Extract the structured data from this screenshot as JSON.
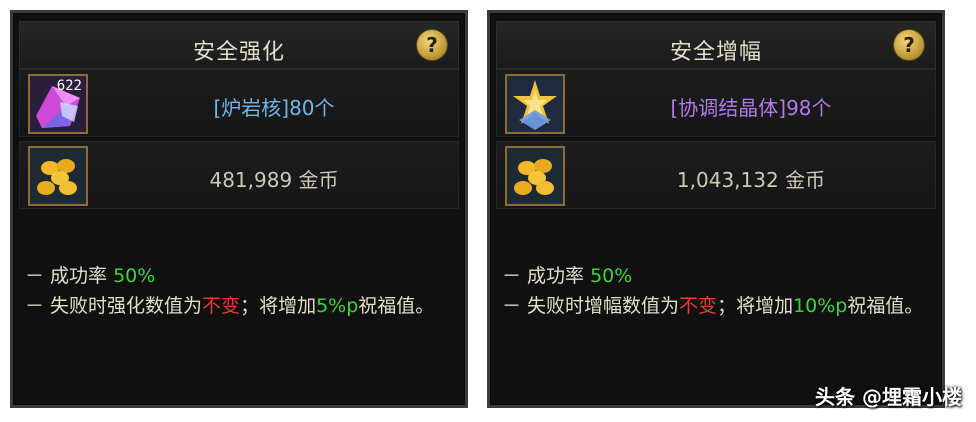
{
  "left": {
    "title": "安全强化",
    "help": "?",
    "material_count": "622",
    "material_text": "[炉岩核]80个",
    "gold_text": "481,989 金币",
    "rate_prefix": "－ 成功率 ",
    "rate_value": "50%",
    "fail_prefix": "－ 失败时强化数值为",
    "fail_unchanged": "不变",
    "fail_mid": "；将增加",
    "fail_value": "5%p",
    "fail_suffix": "祝福值。"
  },
  "right": {
    "title": "安全增幅",
    "help": "?",
    "material_text": "[协调结晶体]98个",
    "gold_text": "1,043,132 金币",
    "rate_prefix": "－ 成功率 ",
    "rate_value": "50%",
    "fail_prefix": "－ 失败时增幅数值为",
    "fail_unchanged": "不变",
    "fail_mid": "；将增加",
    "fail_value": "10%p",
    "fail_suffix": "祝福值。"
  },
  "watermark": "头条 @埋霜小楼",
  "icons": {
    "left_material": "lava-core-crystal-icon",
    "right_material": "harmony-crystal-icon",
    "gold": "gold-coins-icon",
    "help": "help-question-icon"
  },
  "colors": {
    "success_green": "#37d637",
    "unchanged_red": "#e83a2e",
    "left_material_blue": "#6fb6e8",
    "right_material_purple": "#b07be8"
  }
}
